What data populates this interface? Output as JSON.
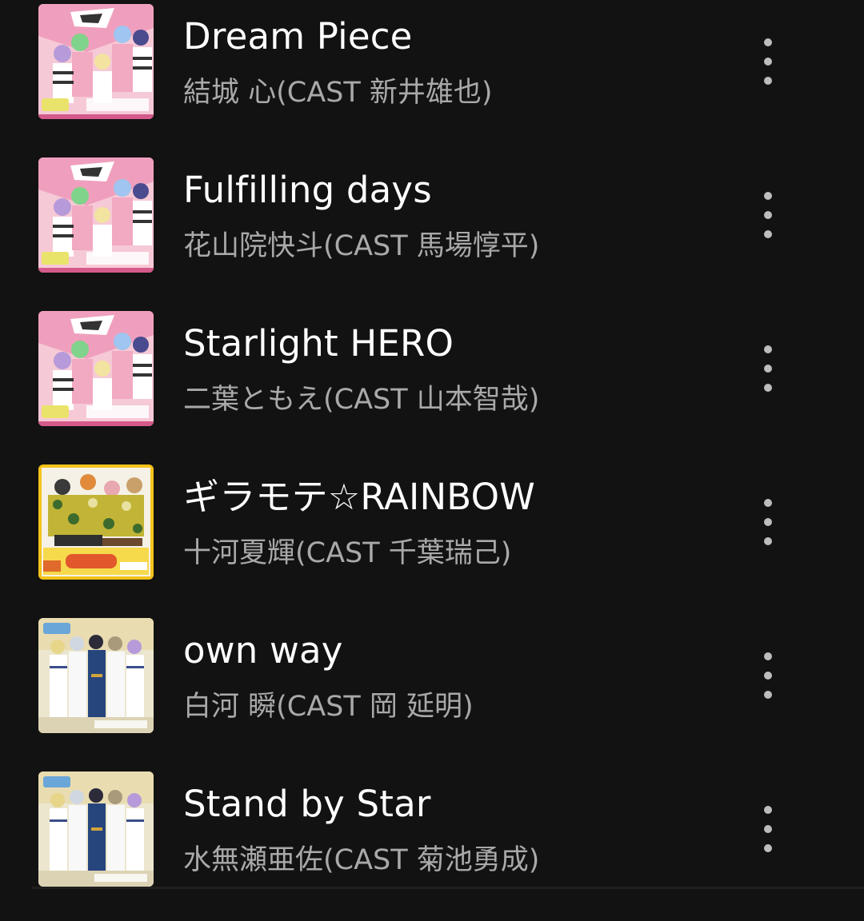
{
  "tracks": [
    {
      "title": "Dream Piece",
      "artist": "結城 心(CAST 新井雄也)",
      "art": "pink-team-cover"
    },
    {
      "title": "Fulfilling days",
      "artist": "花山院快斗(CAST 馬場惇平)",
      "art": "pink-team-cover"
    },
    {
      "title": "Starlight HERO",
      "artist": "二葉ともえ(CAST 山本智哉)",
      "art": "pink-team-cover"
    },
    {
      "title": "ギラモテ☆RAINBOW",
      "artist": "十河夏輝(CAST 千葉瑞己)",
      "art": "yellow-team-cover"
    },
    {
      "title": "own way",
      "artist": "白河 瞬(CAST 岡 延明)",
      "art": "white-team-cover"
    },
    {
      "title": "Stand by Star",
      "artist": "水無瀬亜佐(CAST 菊池勇成)",
      "art": "white-team-cover"
    }
  ],
  "icons": {
    "more": "more-vert-icon"
  },
  "colors": {
    "background": "#121212",
    "title": "#ffffff",
    "artist": "#a9a9a9",
    "more_dots": "#bdbdbd"
  }
}
